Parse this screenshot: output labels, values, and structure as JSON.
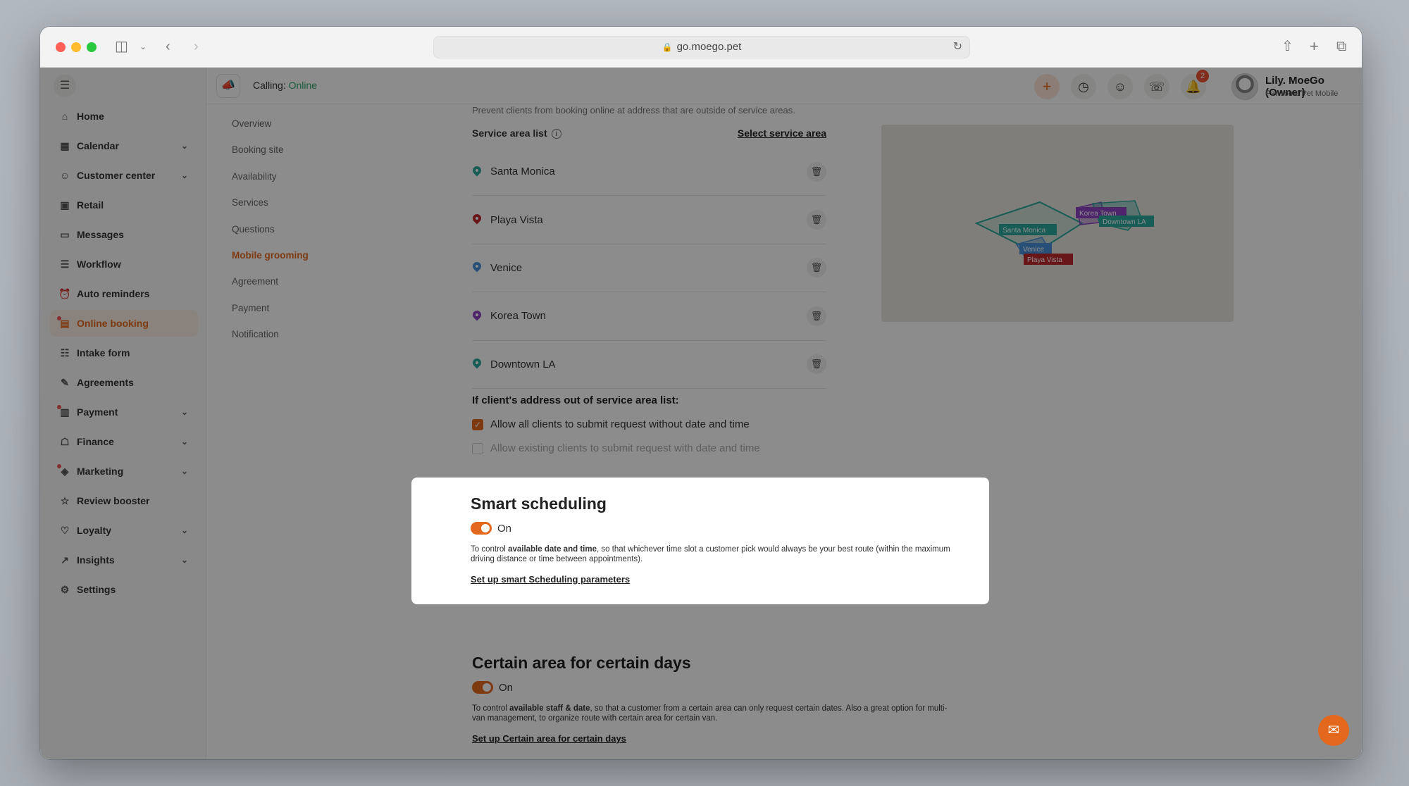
{
  "browser": {
    "url": "go.moego.pet"
  },
  "sidebar": {
    "items": [
      {
        "label": "Home",
        "icon": "home-icon",
        "has_chevron": false,
        "dot": false,
        "active": false
      },
      {
        "label": "Calendar",
        "icon": "calendar-icon",
        "has_chevron": true,
        "dot": false,
        "active": false
      },
      {
        "label": "Customer center",
        "icon": "user-icon",
        "has_chevron": true,
        "dot": false,
        "active": false
      },
      {
        "label": "Retail",
        "icon": "bag-icon",
        "has_chevron": false,
        "dot": false,
        "active": false
      },
      {
        "label": "Messages",
        "icon": "message-icon",
        "has_chevron": false,
        "dot": false,
        "active": false
      },
      {
        "label": "Workflow",
        "icon": "workflow-icon",
        "has_chevron": false,
        "dot": false,
        "active": false
      },
      {
        "label": "Auto reminders",
        "icon": "reminder-icon",
        "has_chevron": false,
        "dot": false,
        "active": false
      },
      {
        "label": "Online booking",
        "icon": "booking-icon",
        "has_chevron": false,
        "dot": true,
        "active": true
      },
      {
        "label": "Intake form",
        "icon": "form-icon",
        "has_chevron": false,
        "dot": false,
        "active": false
      },
      {
        "label": "Agreements",
        "icon": "pen-icon",
        "has_chevron": false,
        "dot": false,
        "active": false
      },
      {
        "label": "Payment",
        "icon": "payment-icon",
        "has_chevron": true,
        "dot": true,
        "active": false
      },
      {
        "label": "Finance",
        "icon": "bank-icon",
        "has_chevron": true,
        "dot": false,
        "active": false
      },
      {
        "label": "Marketing",
        "icon": "megaphone-icon",
        "has_chevron": true,
        "dot": true,
        "active": false
      },
      {
        "label": "Review booster",
        "icon": "review-icon",
        "has_chevron": false,
        "dot": false,
        "active": false
      },
      {
        "label": "Loyalty",
        "icon": "heart-icon",
        "has_chevron": true,
        "dot": false,
        "active": false
      },
      {
        "label": "Insights",
        "icon": "chart-icon",
        "has_chevron": true,
        "dot": false,
        "active": false
      },
      {
        "label": "Settings",
        "icon": "gear-icon",
        "has_chevron": false,
        "dot": false,
        "active": false
      }
    ]
  },
  "topbar": {
    "calling_label": "Calling:",
    "calling_status": "Online",
    "notification_count": "2",
    "user_name": "Lily. MoeGo (Owner)",
    "user_org": "Pawsome Pet Mobile"
  },
  "subnav": {
    "items": [
      "Overview",
      "Booking site",
      "Availability",
      "Services",
      "Questions",
      "Mobile grooming",
      "Agreement",
      "Payment",
      "Notification"
    ],
    "active": "Mobile grooming"
  },
  "service_area": {
    "description": "Prevent clients from booking online at address that are outside of service areas.",
    "list_label": "Service area list",
    "select_link": "Select service area",
    "areas": [
      {
        "name": "Santa Monica",
        "color": "#2aa89b"
      },
      {
        "name": "Playa Vista",
        "color": "#c0282f"
      },
      {
        "name": "Venice",
        "color": "#4a90d9"
      },
      {
        "name": "Korea Town",
        "color": "#8e44c4"
      },
      {
        "name": "Downtown LA",
        "color": "#2aa89b"
      }
    ],
    "out_of_area_title": "If client's address out of service area list:",
    "options": [
      {
        "label": "Allow all clients to submit request without date and time",
        "checked": true,
        "disabled": false
      },
      {
        "label": "Allow existing clients to submit request with date and time",
        "checked": false,
        "disabled": true
      }
    ]
  },
  "map": {
    "labels": [
      {
        "name": "Korea Town",
        "color": "#8e44c4"
      },
      {
        "name": "Downtown LA",
        "color": "#2aa89b"
      },
      {
        "name": "Santa Monica",
        "color": "#2aa89b"
      },
      {
        "name": "Venice",
        "color": "#4a90d9"
      },
      {
        "name": "Playa Vista",
        "color": "#c0282f"
      }
    ]
  },
  "smart_scheduling": {
    "title": "Smart scheduling",
    "toggle_label": "On",
    "desc_prefix": "To control ",
    "desc_bold": "available date and time",
    "desc_suffix": ", so that whichever time slot a customer pick would always be your best route (within the maximum driving distance or time between appointments).",
    "link": "Set up smart Scheduling parameters"
  },
  "certain_area": {
    "title": "Certain area for certain days",
    "toggle_label": "On",
    "desc_prefix": "To control ",
    "desc_bold": "available staff & date",
    "desc_suffix": ", so that a customer from a certain area can only request certain dates. Also a great option for multi-van management, to organize route with certain area for certain van.",
    "link": "Set up Certain area for certain days"
  },
  "colors": {
    "accent": "#e3681d",
    "online": "#33a36b"
  }
}
